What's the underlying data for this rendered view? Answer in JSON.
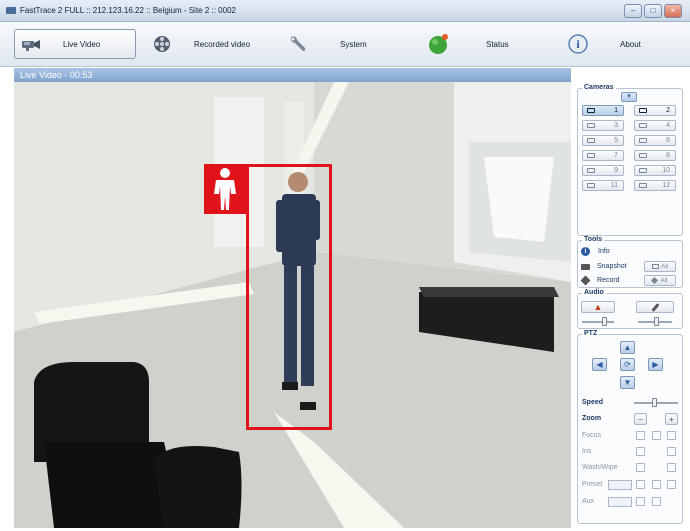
{
  "window": {
    "title": "FastTrace 2 FULL :: 212.123.16.22 :: Belgium - Site 2 :: 0002",
    "buttons": [
      "minimize",
      "maximize",
      "close"
    ]
  },
  "toolbar": {
    "items": [
      {
        "label": "Live Video",
        "icon": "camera-icon",
        "active": true
      },
      {
        "label": "Recorded video",
        "icon": "film-reel-icon",
        "active": false
      },
      {
        "label": "System",
        "icon": "wrench-icon",
        "active": false
      },
      {
        "label": "Status",
        "icon": "status-green-icon",
        "active": false
      },
      {
        "label": "About",
        "icon": "info-icon",
        "active": false
      }
    ]
  },
  "video": {
    "header": "Live Video - 00:53",
    "detection_icon": "person-icon",
    "colors": {
      "detection_box": "#e0121a",
      "header": "#8fb0d8"
    }
  },
  "cameras": {
    "title": "Cameras",
    "numbers": [
      "1",
      "2",
      "3",
      "4",
      "5",
      "6",
      "7",
      "8",
      "9",
      "10",
      "11",
      "12"
    ],
    "active": "1",
    "enabled": [
      "1",
      "2"
    ]
  },
  "tools": {
    "title": "Tools",
    "info_label": "Info",
    "snapshot_label": "Snapshot",
    "record_label": "Record",
    "all_label": "All"
  },
  "audio": {
    "title": "Audio"
  },
  "ptz": {
    "title": "PTZ",
    "speed_label": "Speed",
    "zoom_label": "Zoom",
    "focus_label": "Focus",
    "iris_label": "Iris",
    "washwipe_label": "Wash/Wipe",
    "preset_label": "Preset",
    "aux_label": "Aux"
  }
}
